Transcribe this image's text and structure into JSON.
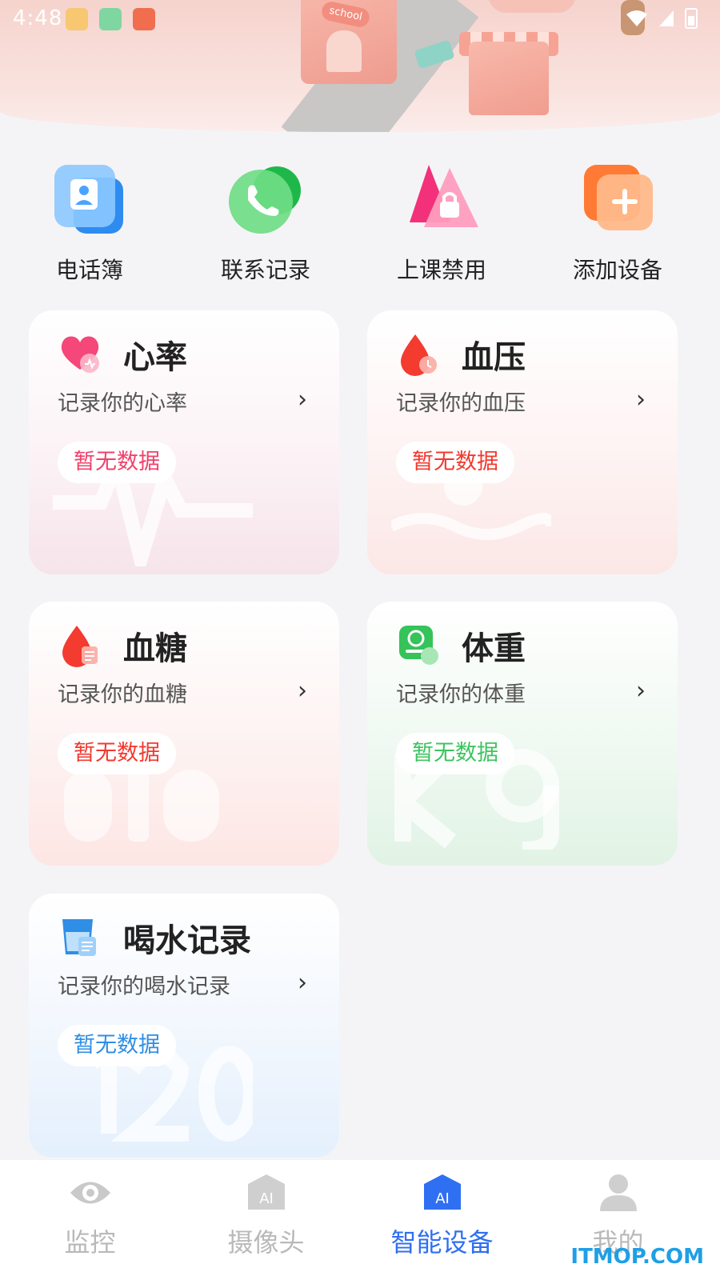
{
  "status_bar": {
    "time": "4:48",
    "icons": [
      "app-notification-icon",
      "app-notification-icon",
      "book-app-icon",
      "wifi-icon",
      "signal-icon",
      "battery-charging-icon"
    ]
  },
  "banner": {
    "school_sign": "school"
  },
  "quick_actions": [
    {
      "label": "电话簿",
      "icon": "contacts-icon",
      "color": "#4aa3ff"
    },
    {
      "label": "联系记录",
      "icon": "phone-icon",
      "color": "#35c35a"
    },
    {
      "label": "上课禁用",
      "icon": "lock-icon",
      "color": "#ff6b9a"
    },
    {
      "label": "添加设备",
      "icon": "add-device-icon",
      "color": "#ff8a4a"
    }
  ],
  "cards": [
    {
      "title": "心率",
      "subtitle": "记录你的心率",
      "badge": "暂无数据",
      "arrow": "›",
      "icon": "heart-icon",
      "badge_color": "#f0416b"
    },
    {
      "title": "血压",
      "subtitle": "记录你的血压",
      "badge": "暂无数据",
      "arrow": "›",
      "icon": "blood-drop-icon",
      "badge_color": "#f2392f"
    },
    {
      "title": "血糖",
      "subtitle": "记录你的血糖",
      "badge": "暂无数据",
      "arrow": "›",
      "icon": "blood-sugar-icon",
      "badge_color": "#f2392f"
    },
    {
      "title": "体重",
      "subtitle": "记录你的体重",
      "badge": "暂无数据",
      "arrow": "›",
      "icon": "scale-icon",
      "badge_color": "#3cc45f"
    },
    {
      "title": "喝水记录",
      "subtitle": "记录你的喝水记录",
      "badge": "暂无数据",
      "arrow": "›",
      "icon": "water-cup-icon",
      "badge_color": "#2f8ee6"
    }
  ],
  "tabs": [
    {
      "label": "监控",
      "icon": "eye-icon",
      "active": false
    },
    {
      "label": "摄像头",
      "icon": "ai-camera-icon",
      "active": false
    },
    {
      "label": "智能设备",
      "icon": "ai-device-icon",
      "active": true,
      "icon_text": "AI"
    },
    {
      "label": "我的",
      "icon": "profile-icon",
      "active": false
    }
  ],
  "watermark": "ITMOP.COM",
  "colors": {
    "accent": "#2f6ff2",
    "background": "#f4f4f6"
  }
}
